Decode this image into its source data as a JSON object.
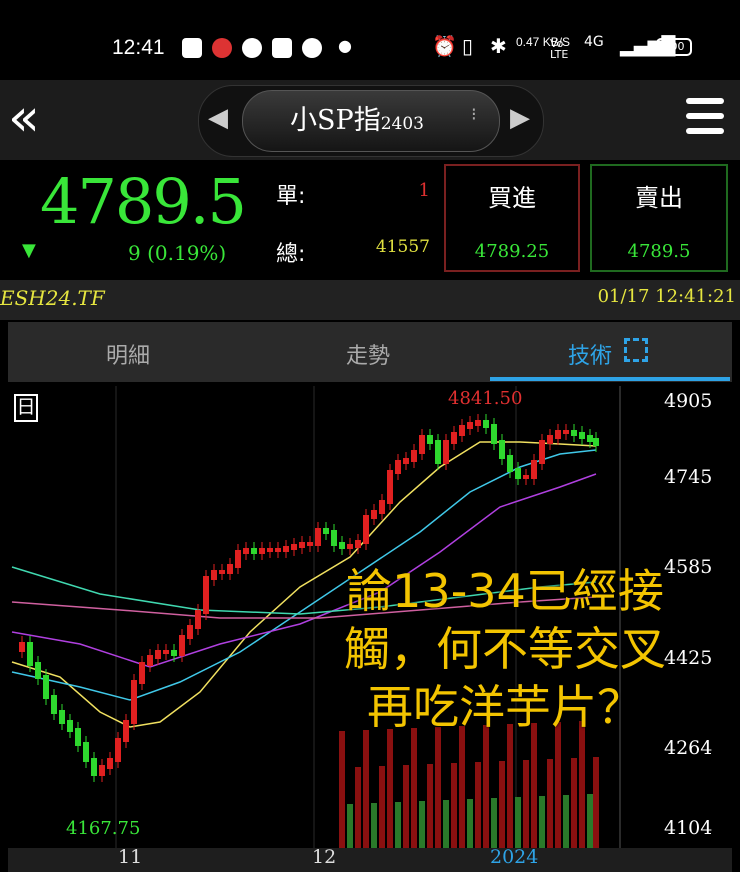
{
  "status_bar": {
    "time": "12:41",
    "speed": "0.47 KB/S",
    "network": "4G",
    "battery": "100"
  },
  "nav": {
    "back_label": "«",
    "symbol_name": "小SP指",
    "symbol_code": "2403",
    "prev_label": "◀",
    "next_label": "▶"
  },
  "quote": {
    "price": "4789.5",
    "direction": "▼",
    "change": "9 (0.19%)",
    "unit_label": "單:",
    "unit_value": "1",
    "total_label": "總:",
    "total_value": "41557",
    "buy_label": "買進",
    "buy_price": "4789.25",
    "sell_label": "賣出",
    "sell_price": "4789.5"
  },
  "ticker": {
    "code": "ESH24.TF",
    "datetime": "01/17 12:41:21"
  },
  "tabs": [
    {
      "label": "明細"
    },
    {
      "label": "走勢"
    },
    {
      "label": "技術"
    }
  ],
  "chart": {
    "period_label": "日",
    "high_label": "4841.50",
    "low_label": "4167.75",
    "y_ticks": [
      "4905",
      "4745",
      "4585",
      "4425",
      "4264",
      "4104"
    ],
    "x_ticks": [
      "11",
      "12",
      "2024"
    ],
    "note": "論13-34已經接觸，何不等交叉再吃洋芋片？"
  },
  "colors": {
    "up": "#e02020",
    "down": "#2ed82e",
    "accent": "#2ea3e6",
    "note": "#f3c400"
  }
}
